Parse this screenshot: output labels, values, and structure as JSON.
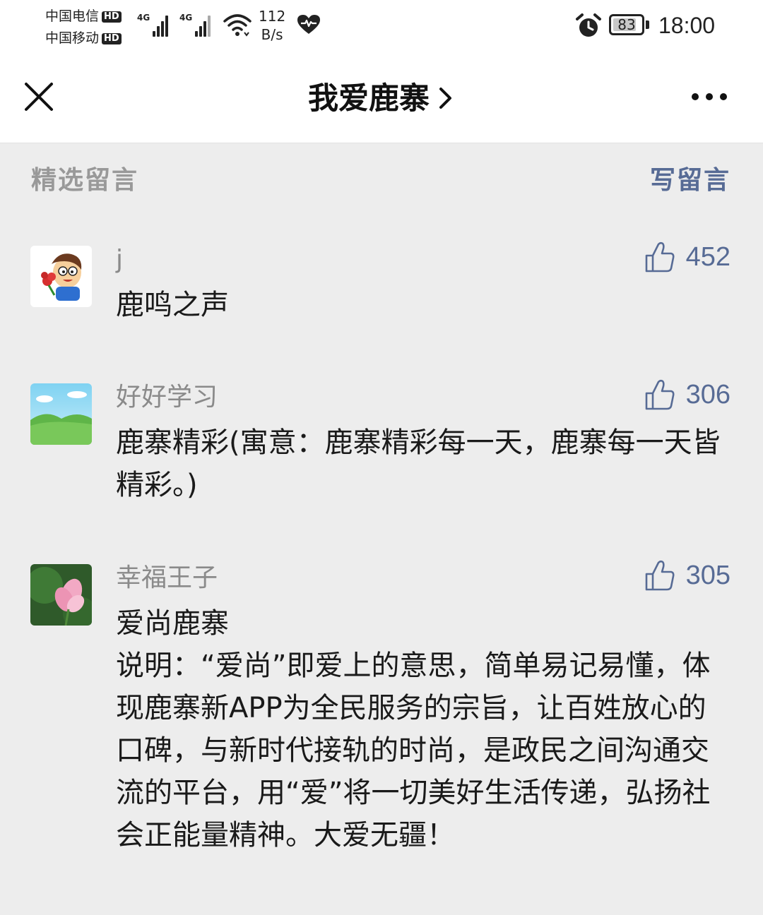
{
  "status_bar": {
    "carrier_1": "中国电信",
    "carrier_2": "中国移动",
    "hd_label": "HD",
    "network_1": "4G",
    "network_2": "4G",
    "speed_value": "112",
    "speed_unit": "B/s",
    "battery_level": "83",
    "battery_fraction": 0.83,
    "time": "18:00"
  },
  "nav": {
    "title": "我爱鹿寨"
  },
  "section": {
    "title": "精选留言",
    "write_label": "写留言"
  },
  "comments": [
    {
      "author": "j",
      "likes": "452",
      "text": "鹿鸣之声"
    },
    {
      "author": "好好学习",
      "likes": "306",
      "text": "鹿寨精彩(寓意：鹿寨精彩每一天，鹿寨每一天皆精彩。)"
    },
    {
      "author": "幸福王子",
      "likes": "305",
      "text": "爱尚鹿寨\n说明：“爱尚”即爱上的意思，简单易记易懂，体现鹿寨新APP为全民服务的宗旨，让百姓放心的口碑，与新时代接轨的时尚，是政民之间沟通交流的平台，用“爱”将一切美好生活传递，弘扬社会正能量精神。大爱无疆！"
    }
  ],
  "colors": {
    "link_blue": "#576b95",
    "page_bg": "#ededed",
    "muted_gray": "#999999"
  }
}
